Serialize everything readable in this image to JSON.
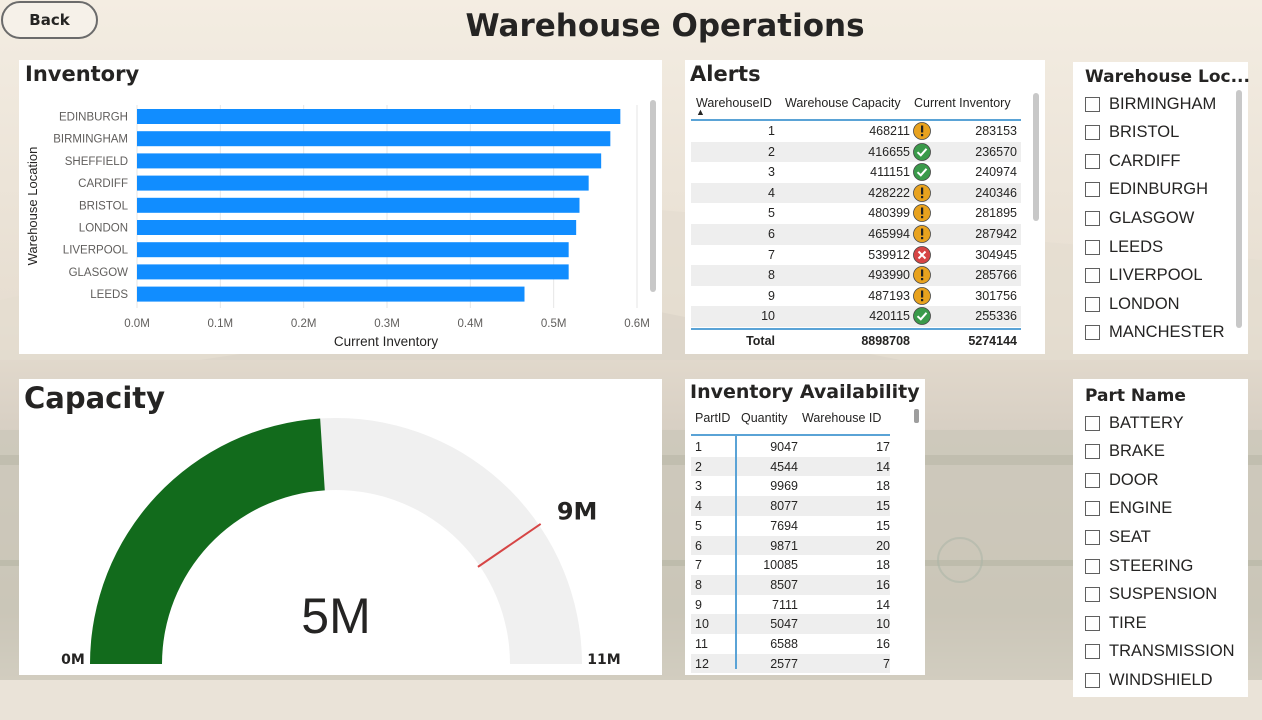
{
  "header": {
    "back_label": "Back",
    "title": "Warehouse Operations"
  },
  "inventory_chart": {
    "title": "Inventory",
    "chart_data": {
      "type": "bar",
      "orientation": "horizontal",
      "categories": [
        "EDINBURGH",
        "BIRMINGHAM",
        "SHEFFIELD",
        "CARDIFF",
        "BRISTOL",
        "LONDON",
        "LIVERPOOL",
        "GLASGOW",
        "LEEDS"
      ],
      "values": [
        580000,
        568000,
        557000,
        542000,
        531000,
        527000,
        518000,
        518000,
        465000
      ],
      "xlabel": "Current Inventory",
      "ylabel": "Warehouse Location",
      "xlim": [
        0,
        600000
      ],
      "xticks": [
        0,
        100000,
        200000,
        300000,
        400000,
        500000,
        600000
      ],
      "xtick_labels": [
        "0.0M",
        "0.1M",
        "0.2M",
        "0.3M",
        "0.4M",
        "0.5M",
        "0.6M"
      ],
      "grid": true,
      "color": "#118dff"
    }
  },
  "alerts": {
    "title": "Alerts",
    "columns": [
      "WarehouseID",
      "Warehouse Capacity",
      "Current Inventory"
    ],
    "rows": [
      {
        "id": "1",
        "capacity": "468211",
        "status": "warning",
        "inventory": "283153"
      },
      {
        "id": "2",
        "capacity": "416655",
        "status": "ok",
        "inventory": "236570"
      },
      {
        "id": "3",
        "capacity": "411151",
        "status": "ok",
        "inventory": "240974"
      },
      {
        "id": "4",
        "capacity": "428222",
        "status": "warning",
        "inventory": "240346"
      },
      {
        "id": "5",
        "capacity": "480399",
        "status": "warning",
        "inventory": "281895"
      },
      {
        "id": "6",
        "capacity": "465994",
        "status": "warning",
        "inventory": "287942"
      },
      {
        "id": "7",
        "capacity": "539912",
        "status": "error",
        "inventory": "304945"
      },
      {
        "id": "8",
        "capacity": "493990",
        "status": "warning",
        "inventory": "285766"
      },
      {
        "id": "9",
        "capacity": "487193",
        "status": "warning",
        "inventory": "301756"
      },
      {
        "id": "10",
        "capacity": "420115",
        "status": "ok",
        "inventory": "255336"
      }
    ],
    "total_label": "Total",
    "total_capacity": "8898708",
    "total_inventory": "5274144",
    "status_colors": {
      "warning": "#e8a21e",
      "ok": "#3a9a4a",
      "error": "#d64545"
    }
  },
  "warehouse_slicer": {
    "title": "Warehouse Loc...",
    "items": [
      "BIRMINGHAM",
      "BRISTOL",
      "CARDIFF",
      "EDINBURGH",
      "GLASGOW",
      "LEEDS",
      "LIVERPOOL",
      "LONDON",
      "MANCHESTER"
    ]
  },
  "capacity_gauge": {
    "title": "Capacity",
    "chart_data": {
      "type": "gauge",
      "value": 5274144,
      "value_label": "5M",
      "min": 0,
      "min_label": "0M",
      "max": 11000000,
      "max_label": "11M",
      "target": 8898708,
      "target_label": "9M",
      "fill_color": "#126b1c",
      "track_color": "#f0f0f0",
      "target_color": "#d64545"
    }
  },
  "availability": {
    "title": "Inventory Availability",
    "columns": [
      "PartID",
      "Quantity",
      "Warehouse ID"
    ],
    "rows": [
      [
        "1",
        "9047",
        "17"
      ],
      [
        "2",
        "4544",
        "14"
      ],
      [
        "3",
        "9969",
        "18"
      ],
      [
        "4",
        "8077",
        "15"
      ],
      [
        "5",
        "7694",
        "15"
      ],
      [
        "6",
        "9871",
        "20"
      ],
      [
        "7",
        "10085",
        "18"
      ],
      [
        "8",
        "8507",
        "16"
      ],
      [
        "9",
        "7111",
        "14"
      ],
      [
        "10",
        "5047",
        "10"
      ],
      [
        "11",
        "6588",
        "16"
      ],
      [
        "12",
        "2577",
        "7"
      ]
    ]
  },
  "part_slicer": {
    "title": "Part Name",
    "items": [
      "BATTERY",
      "BRAKE",
      "DOOR",
      "ENGINE",
      "SEAT",
      "STEERING",
      "SUSPENSION",
      "TIRE",
      "TRANSMISSION",
      "WINDSHIELD"
    ]
  }
}
